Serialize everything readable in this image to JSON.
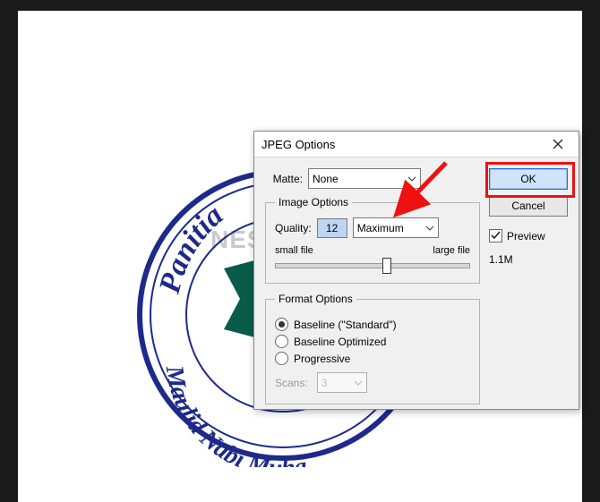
{
  "stamp": {
    "text_top": "Panitia",
    "text_bottom_prefix": "Maulid Nabi Muha"
  },
  "watermark": {
    "text": "NESABAMEDIA",
    "accent": "#7ec9d6"
  },
  "dialog": {
    "title": "JPEG Options",
    "matte_label": "Matte:",
    "matte_value": "None",
    "image_options_legend": "Image Options",
    "quality_label": "Quality:",
    "quality_value": "12",
    "quality_preset": "Maximum",
    "slider_small": "small file",
    "slider_large": "large file",
    "slider_pos_pct": 55,
    "format_options_legend": "Format Options",
    "radio": {
      "standard": "Baseline (\"Standard\")",
      "optimized": "Baseline Optimized",
      "progressive": "Progressive",
      "selected": "standard"
    },
    "scans_label": "Scans:",
    "scans_value": "3",
    "ok": "OK",
    "cancel": "Cancel",
    "preview_label": "Preview",
    "preview_checked": true,
    "file_size": "1.1M"
  }
}
